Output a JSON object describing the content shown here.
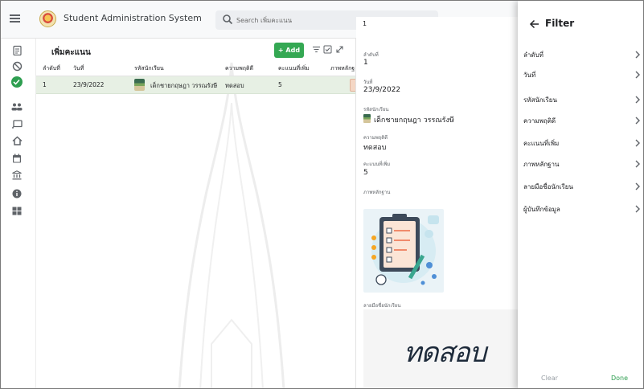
{
  "app": {
    "title": "Student Administration System"
  },
  "search": {
    "placeholder": "Search เพิ่มคะแนน"
  },
  "sidebar": {
    "items": [
      {
        "icon": "clipboard-icon",
        "active": false
      },
      {
        "icon": "block-icon",
        "active": false
      },
      {
        "icon": "check-circle-icon",
        "active": true
      },
      {
        "icon": "people-icon",
        "active": false
      },
      {
        "icon": "cast-icon",
        "active": false
      },
      {
        "icon": "home-icon",
        "active": false
      },
      {
        "icon": "calendar-icon",
        "active": false
      },
      {
        "icon": "account-balance-icon",
        "active": false
      },
      {
        "icon": "info-icon",
        "active": false
      },
      {
        "icon": "grid-view-icon",
        "active": false
      }
    ]
  },
  "table": {
    "title": "เพิ่มคะแนน",
    "add_label": "+ Add",
    "columns": [
      "ลำดับที่",
      "วันที่",
      "รหัสนักเรียน",
      "ความพฤติดี",
      "คะแนนที่เพิ่ม",
      "ภาพหลักฐ"
    ],
    "rows": [
      {
        "order": "1",
        "date": "23/9/2022",
        "student": "เด็กชายกฤษฎา วรรณรังษี",
        "behavior": "ทดสอบ",
        "points": "5"
      }
    ]
  },
  "detail": {
    "header": "1",
    "fields": [
      {
        "label": "ลำดับที่",
        "value": "1"
      },
      {
        "label": "วันที่",
        "value": "23/9/2022"
      },
      {
        "label": "รหัสนักเรียน",
        "value": "เด็กชายกฤษฎา  วรรณรังษี"
      },
      {
        "label": "ความพฤติดี",
        "value": "ทดสอบ"
      },
      {
        "label": "คะแนนที่เพิ่ม",
        "value": "5"
      }
    ],
    "evidence_label": "ภาพหลักฐาน",
    "signature_label": "ลายมือชื่อนักเรียน",
    "signature_text": "ทดสอบ"
  },
  "filter": {
    "title": "Filter",
    "items": [
      "ลำดับที่",
      "วันที่",
      "รหัสนักเรียน",
      "ความพฤติดี",
      "คะแนนที่เพิ่ม",
      "ภาพหลักฐาน",
      "ลายมือชื่อนักเรียน",
      "ผู้บันทึกข้อมูล"
    ],
    "clear_label": "Clear",
    "done_label": "Done"
  },
  "colors": {
    "accent": "#34a853",
    "selected_row": "#e7f0e4"
  }
}
